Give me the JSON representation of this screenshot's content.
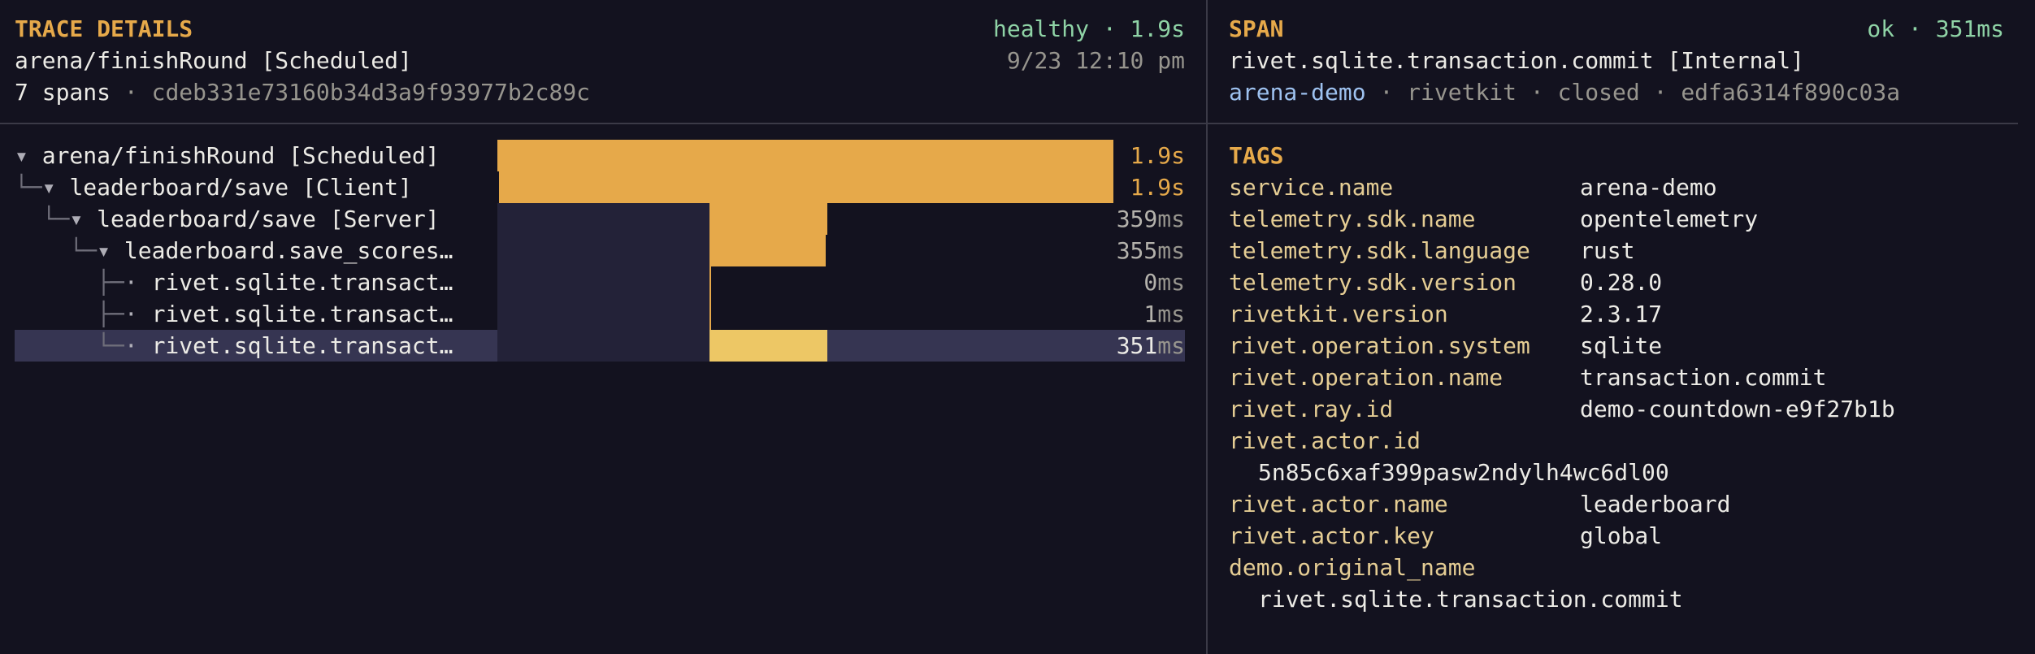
{
  "trace": {
    "section_label": "TRACE DETAILS",
    "status": "healthy · 1.9s",
    "name": "arena/finishRound [Scheduled]",
    "timestamp": "9/23 12:10 pm",
    "span_count": "7 spans",
    "separator": "·",
    "trace_id": "cdeb331e73160b34d3a9f93977b2c89c"
  },
  "tree": [
    {
      "prefix": "",
      "toggle": "▾",
      "label": "arena/finishRound [Scheduled]",
      "dur_num": "1.9",
      "dur_unit": "s",
      "bar_start": 0.0,
      "bar_end": 1.0,
      "selected": false
    },
    {
      "prefix": "└─",
      "toggle": "▾",
      "label": "leaderboard/save [Client]",
      "dur_num": "1.9",
      "dur_unit": "s",
      "bar_start": 0.002,
      "bar_end": 1.0,
      "selected": false
    },
    {
      "prefix": "  └─",
      "toggle": "▾",
      "label": "leaderboard/save [Server]",
      "dur_num": "359",
      "dur_unit": "ms",
      "bar_start": 0.344,
      "bar_end": 0.535,
      "selected": false
    },
    {
      "prefix": "    └─",
      "toggle": "▾",
      "label": "leaderboard.save_scores…",
      "dur_num": "355",
      "dur_unit": "ms",
      "bar_start": 0.344,
      "bar_end": 0.533,
      "selected": false
    },
    {
      "prefix": "      ├─",
      "toggle": "·",
      "label": "rivet.sqlite.transact…",
      "dur_num": "0",
      "dur_unit": "ms",
      "bar_start": 0.344,
      "bar_end": 0.3445,
      "selected": false
    },
    {
      "prefix": "      ├─",
      "toggle": "·",
      "label": "rivet.sqlite.transact…",
      "dur_num": "1",
      "dur_unit": "ms",
      "bar_start": 0.344,
      "bar_end": 0.3455,
      "selected": false
    },
    {
      "prefix": "      └─",
      "toggle": "·",
      "label": "rivet.sqlite.transact…",
      "dur_num": "351",
      "dur_unit": "ms",
      "bar_start": 0.344,
      "bar_end": 0.535,
      "selected": true
    }
  ],
  "span": {
    "section_label": "SPAN",
    "status": "ok · 351ms",
    "name": "rivet.sqlite.transaction.commit [Internal]",
    "service": "arena-demo",
    "library": "rivetkit",
    "state": "closed",
    "span_id": "edfa6314f890c03a",
    "separator": "·"
  },
  "tags": {
    "section_label": "TAGS",
    "items": [
      {
        "key": "service.name",
        "value": "arena-demo",
        "wrap": false
      },
      {
        "key": "telemetry.sdk.name",
        "value": "opentelemetry",
        "wrap": false
      },
      {
        "key": "telemetry.sdk.language",
        "value": "rust",
        "wrap": false
      },
      {
        "key": "telemetry.sdk.version",
        "value": "0.28.0",
        "wrap": false
      },
      {
        "key": "rivetkit.version",
        "value": "2.3.17",
        "wrap": false
      },
      {
        "key": "rivet.operation.system",
        "value": "sqlite",
        "wrap": false
      },
      {
        "key": "rivet.operation.name",
        "value": "transaction.commit",
        "wrap": false
      },
      {
        "key": "rivet.ray.id",
        "value": "demo-countdown-e9f27b1b",
        "wrap": false
      },
      {
        "key": "rivet.actor.id",
        "value": "5n85c6xaf399pasw2ndylh4wc6dl00",
        "wrap": true
      },
      {
        "key": "rivet.actor.name",
        "value": "leaderboard",
        "wrap": false
      },
      {
        "key": "rivet.actor.key",
        "value": "global",
        "wrap": false
      },
      {
        "key": "demo.original_name",
        "value": "rivet.sqlite.transaction.commit",
        "wrap": true
      }
    ]
  },
  "colors": {
    "accent": "#e6a94a",
    "selected_bar": "#edc765",
    "healthy": "#8fd3a6",
    "service_link": "#9ec2f0",
    "tag_key": "#e5cd94"
  }
}
